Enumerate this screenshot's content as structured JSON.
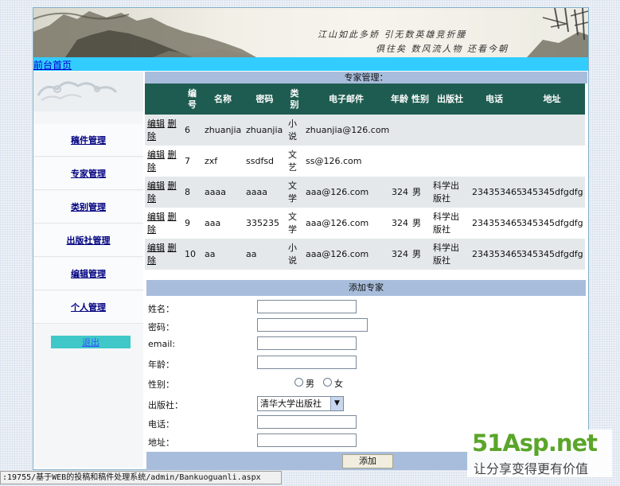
{
  "banner": {
    "poem_line1": "江山如此多娇 引无数英雄竞折腰",
    "poem_line2": "俱往矣 数风流人物 还看今朝"
  },
  "topbar": {
    "home_link": "前台首页"
  },
  "sidebar": {
    "items": [
      {
        "label": "稿件管理"
      },
      {
        "label": "专家管理"
      },
      {
        "label": "类别管理"
      },
      {
        "label": "出版社管理"
      },
      {
        "label": "编辑管理"
      },
      {
        "label": "个人管理"
      }
    ],
    "logout": "退出"
  },
  "main": {
    "title": "专家管理：",
    "table": {
      "headers": [
        "",
        "编号",
        "名称",
        "密码",
        "类别",
        "电子邮件",
        "年龄",
        "性别",
        "出版社",
        "电话",
        "地址"
      ],
      "edit_label": "编辑",
      "delete_label": "删除",
      "rows": [
        {
          "id": "6",
          "name": "zhuanjia",
          "password": "zhuanjia",
          "category": "小说",
          "email": "zhuanjia@126.com",
          "age": "",
          "gender": "",
          "publisher": "",
          "phone": "",
          "address": ""
        },
        {
          "id": "7",
          "name": "zxf",
          "password": "ssdfsd",
          "category": "文艺",
          "email": "ss@126.com",
          "age": "",
          "gender": "",
          "publisher": "",
          "phone": "",
          "address": ""
        },
        {
          "id": "8",
          "name": "aaaa",
          "password": "aaaa",
          "category": "文学",
          "email": "aaa@126.com",
          "age": "324",
          "gender": "男",
          "publisher": "科学出版社",
          "phone": "234353465",
          "address": "345345dfgdfg"
        },
        {
          "id": "9",
          "name": "aaa",
          "password": "335235",
          "category": "文学",
          "email": "aaa@126.com",
          "age": "324",
          "gender": "男",
          "publisher": "科学出版社",
          "phone": "234353465",
          "address": "345345dfgdfg"
        },
        {
          "id": "10",
          "name": "aa",
          "password": "aa",
          "category": "小说",
          "email": "aaa@126.com",
          "age": "324",
          "gender": "男",
          "publisher": "科学出版社",
          "phone": "234353465",
          "address": "345345dfgdfg"
        }
      ]
    },
    "add_title": "添加专家",
    "form": {
      "name_label": "姓名：",
      "password_label": "密码：",
      "email_label": "email:",
      "age_label": "年龄：",
      "gender_label": "性别：",
      "male": "男",
      "female": "女",
      "publisher_label": "出版社：",
      "publisher_value": "清华大学出版社",
      "phone_label": "电话：",
      "address_label": "地址：",
      "submit": "添加"
    }
  },
  "status_bar": {
    "url": ":19755/基于WEB的投稿和稿件处理系统/admin/Bankuoguanli.aspx"
  },
  "watermark": {
    "brand": "51Asp.net",
    "slogan": "让分享变得更有价值"
  }
}
